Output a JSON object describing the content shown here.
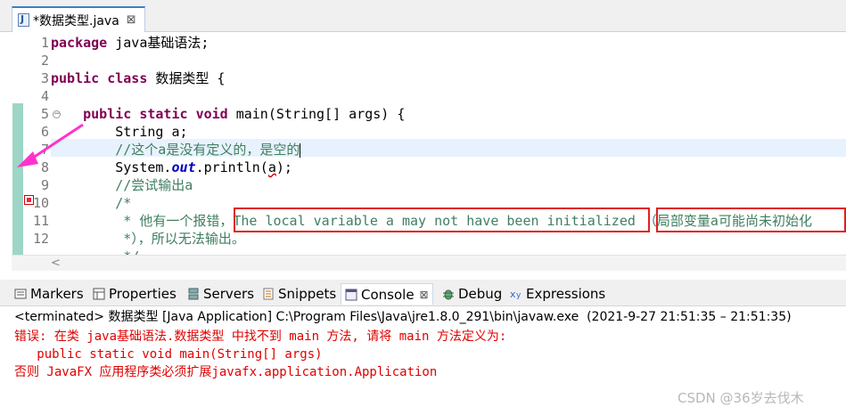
{
  "editor_tab": {
    "title": "*数据类型.java",
    "close": "⊠"
  },
  "code": {
    "line_numbers": [
      "1",
      "2",
      "3",
      "4",
      "5",
      "6",
      "7",
      "8",
      "9",
      "10",
      "11",
      "12"
    ],
    "l1_kw": "package",
    "l1_rest": " java基础语法;",
    "l3_kw1": "public",
    "l3_kw2": "class",
    "l3_rest": " 数据类型 {",
    "l5_indent": "    ",
    "l5_kw1": "public",
    "l5_kw2": "static",
    "l5_kw3": "void",
    "l5_rest": " main(String[] args) {",
    "l6": "        String a;",
    "l7_indent": "        ",
    "l7_comment": "//这个a是没有定义的，是空的",
    "l8_pre": "        System.",
    "l8_field": "out",
    "l8_mid": ".println(",
    "l8_err": "a",
    "l8_post": ");",
    "l9_indent": "        ",
    "l9_comment": "//尝试输出a",
    "l10_indent": "        ",
    "l10_comment": "/*",
    "l11_indent": "         ",
    "l11_comment": "* 他有一个报错，The local variable a may not have been initialized （局部变量a可能尚未初始化",
    "l12_indent": "         ",
    "l12_comment": "*），所以无法输出。",
    "l13_indent": "         ",
    "l13_comment": "*/"
  },
  "views": {
    "markers": "Markers",
    "properties": "Properties",
    "servers": "Servers",
    "snippets": "Snippets",
    "console": "Console",
    "console_close": "⊠",
    "debug": "Debug",
    "expressions": "Expressions"
  },
  "console": {
    "status": "<terminated> 数据类型 [Java Application] C:\\Program Files\\Java\\jre1.8.0_291\\bin\\javaw.exe  (2021-9-27 21:51:35 – 21:51:35)",
    "line1": "错误: 在类 java基础语法.数据类型 中找不到 main 方法, 请将 main 方法定义为:",
    "line2": "   public static void main(String[] args)",
    "line3": "否则 JavaFX 应用程序类必须扩展javafx.application.Application"
  },
  "watermark": "CSDN @36岁去伐木",
  "colors": {
    "keyword": "#7f0055",
    "comment": "#3f7f5f",
    "error": "#e00000",
    "annotation_box": "#e02020",
    "arrow": "#ff33cc"
  },
  "icons": [
    "java-file-icon",
    "close-icon",
    "fold-icon",
    "error-marker-icon",
    "markers-icon",
    "properties-icon",
    "servers-icon",
    "snippets-icon",
    "console-icon",
    "debug-icon",
    "expressions-icon"
  ]
}
